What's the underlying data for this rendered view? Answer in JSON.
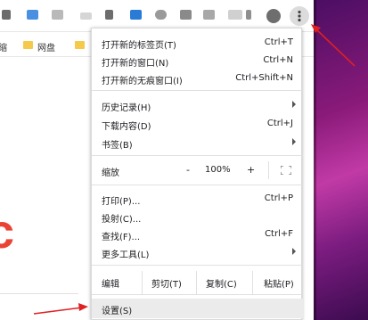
{
  "bookmarks": [
    {
      "label": "缩"
    },
    {
      "label": "网盘"
    }
  ],
  "background_text": {
    "big_letter": "c"
  },
  "menu": {
    "new_tab": {
      "label": "打开新的标签页(T)",
      "shortcut": "Ctrl+T"
    },
    "new_window": {
      "label": "打开新的窗口(N)",
      "shortcut": "Ctrl+N"
    },
    "new_incognito": {
      "label": "打开新的无痕窗口(I)",
      "shortcut": "Ctrl+Shift+N"
    },
    "history": {
      "label": "历史记录(H)"
    },
    "downloads": {
      "label": "下载内容(D)",
      "shortcut": "Ctrl+J"
    },
    "bookmarks": {
      "label": "书签(B)"
    },
    "zoom": {
      "label": "缩放",
      "minus": "-",
      "value": "100%",
      "plus": "+"
    },
    "print": {
      "label": "打印(P)...",
      "shortcut": "Ctrl+P"
    },
    "cast": {
      "label": "投射(C)..."
    },
    "find": {
      "label": "查找(F)...",
      "shortcut": "Ctrl+F"
    },
    "more_tools": {
      "label": "更多工具(L)"
    },
    "edit": {
      "label": "编辑",
      "cut": "剪切(T)",
      "copy": "复制(C)",
      "paste": "粘贴(P)"
    },
    "settings": {
      "label": "设置(S)"
    }
  },
  "colors": {
    "annotation_arrow": "#e02020",
    "folder": "#f5c94a",
    "menu_highlight": "#ebebeb"
  }
}
